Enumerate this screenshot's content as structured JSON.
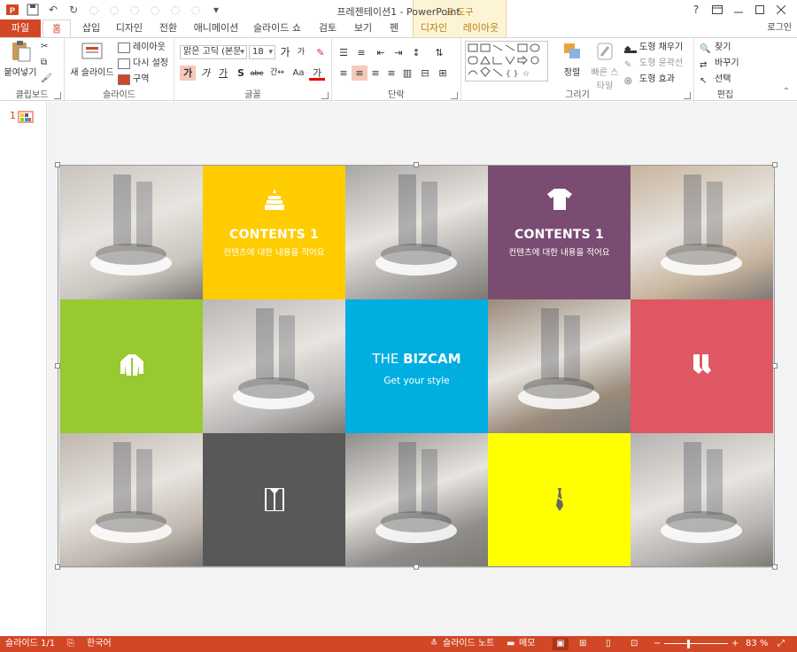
{
  "titlebar": {
    "title": "프레젠테이션1 - PowerPoint",
    "context_group": "표 도구",
    "help": "?",
    "controls": [
      "restore",
      "minimize",
      "maximize",
      "close"
    ]
  },
  "tabs": {
    "file": "파일",
    "home": "홈",
    "items": [
      "삽입",
      "디자인",
      "전환",
      "애니메이션",
      "슬라이드 쇼",
      "검토",
      "보기",
      "펜"
    ],
    "context_tabs": [
      "디자인",
      "레이아웃"
    ],
    "login": "로그인"
  },
  "ribbon": {
    "clipboard": {
      "label": "클립보드",
      "paste": "붙여넣기"
    },
    "slides": {
      "label": "슬라이드",
      "new_slide": "새 슬라이드",
      "layout": "레이아웃",
      "reset": "다시 설정",
      "section": "구역"
    },
    "font": {
      "label": "글꼴",
      "font_name": "맑은 고딕 (본문",
      "font_size": "18",
      "grow": "가",
      "shrink": "가",
      "bold": "가",
      "italic": "가",
      "underline": "가",
      "shadow": "S",
      "strike": "abe",
      "spacing": "간↔",
      "case": "Aa",
      "color": "가"
    },
    "paragraph": {
      "label": "단락"
    },
    "drawing": {
      "label": "그리기",
      "arrange": "정렬",
      "quick_styles": "빠른 스타일",
      "fill": "도형 채우기",
      "outline": "도형 윤곽선",
      "effects": "도형 효과"
    },
    "editing": {
      "label": "편집",
      "find": "찾기",
      "replace": "바꾸기",
      "select": "선택"
    }
  },
  "thumbnails": {
    "slide_number": "1"
  },
  "slide": {
    "cells": [
      {
        "kind": "photo",
        "tone": "#c9c4be"
      },
      {
        "kind": "color",
        "color": "#ffcc00",
        "icon": "cake-icon",
        "title": "CONTENTS 1",
        "subtitle": "컨텐츠에 대한 내용을 적어요"
      },
      {
        "kind": "photo",
        "tone": "#a9a7a5"
      },
      {
        "kind": "color",
        "color": "#7b4c72",
        "icon": "tshirt-icon",
        "title": "CONTENTS 1",
        "subtitle": "컨텐츠에 대한 내용을 적어요"
      },
      {
        "kind": "photo",
        "tone": "#c7b49e"
      },
      {
        "kind": "color",
        "color": "#99c931",
        "icon": "jacket-icon"
      },
      {
        "kind": "photo",
        "tone": "#b9b7b6"
      },
      {
        "kind": "color",
        "color": "#00aee0",
        "title_light": "THE",
        "title_bold": "BIZCAM",
        "subtitle": "Get your style"
      },
      {
        "kind": "photo",
        "tone": "#9a8b7b"
      },
      {
        "kind": "color",
        "color": "#e05764",
        "icon": "socks-icon"
      },
      {
        "kind": "photo",
        "tone": "#bfb7af"
      },
      {
        "kind": "color",
        "color": "#585858",
        "icon": "shirt-icon"
      },
      {
        "kind": "photo",
        "tone": "#8f8d8b"
      },
      {
        "kind": "color",
        "color": "#ffff00",
        "icon": "tie-icon"
      },
      {
        "kind": "photo",
        "tone": "#b5b3b0"
      }
    ]
  },
  "statusbar": {
    "slide_info": "슬라이드 1/1",
    "language": "한국어",
    "notes": "슬라이드 노트",
    "comments": "메모",
    "zoom": "83 %",
    "zoom_minus": "−",
    "zoom_plus": "+"
  }
}
